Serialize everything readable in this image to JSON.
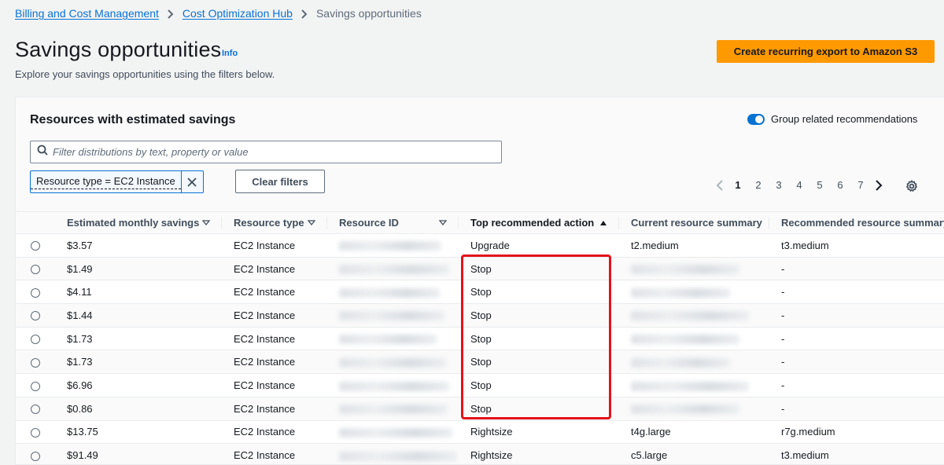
{
  "breadcrumb": {
    "items": [
      "Billing and Cost Management",
      "Cost Optimization Hub"
    ],
    "current": "Savings opportunities"
  },
  "page": {
    "title": "Savings opportunities",
    "info": "Info",
    "description": "Explore your savings opportunities using the filters below.",
    "export_button": "Create recurring export to Amazon S3"
  },
  "panel": {
    "title": "Resources with estimated savings",
    "toggle_label": "Group related recommendations",
    "search_placeholder": "Filter distributions by text, property or value",
    "filter_token": "Resource type = EC2 Instance",
    "clear_filters": "Clear filters"
  },
  "pagination": {
    "pages": [
      "1",
      "2",
      "3",
      "4",
      "5",
      "6",
      "7"
    ],
    "current": "1"
  },
  "table": {
    "headers": [
      "Estimated monthly savings",
      "Resource type",
      "Resource ID",
      "Top recommended action",
      "Current resource summary",
      "Recommended resource summary"
    ],
    "rows": [
      {
        "savings": "$3.57",
        "type": "EC2 Instance",
        "action": "Upgrade",
        "current": "t2.medium",
        "recommended": "t3.medium"
      },
      {
        "savings": "$1.49",
        "type": "EC2 Instance",
        "action": "Stop",
        "current": "",
        "recommended": "-"
      },
      {
        "savings": "$4.11",
        "type": "EC2 Instance",
        "action": "Stop",
        "current": "",
        "recommended": "-"
      },
      {
        "savings": "$1.44",
        "type": "EC2 Instance",
        "action": "Stop",
        "current": "",
        "recommended": "-"
      },
      {
        "savings": "$1.73",
        "type": "EC2 Instance",
        "action": "Stop",
        "current": "",
        "recommended": "-"
      },
      {
        "savings": "$1.73",
        "type": "EC2 Instance",
        "action": "Stop",
        "current": "",
        "recommended": "-"
      },
      {
        "savings": "$6.96",
        "type": "EC2 Instance",
        "action": "Stop",
        "current": "",
        "recommended": "-"
      },
      {
        "savings": "$0.86",
        "type": "EC2 Instance",
        "action": "Stop",
        "current": "",
        "recommended": "-"
      },
      {
        "savings": "$13.75",
        "type": "EC2 Instance",
        "action": "Rightsize",
        "current": "t4g.large",
        "recommended": "r7g.medium"
      },
      {
        "savings": "$91.49",
        "type": "EC2 Instance",
        "action": "Rightsize",
        "current": "c5.large",
        "recommended": "t3.medium"
      }
    ]
  },
  "colors": {
    "accent": "#0972d3",
    "primary_button": "#ff9900",
    "highlight": "#e3121b"
  }
}
